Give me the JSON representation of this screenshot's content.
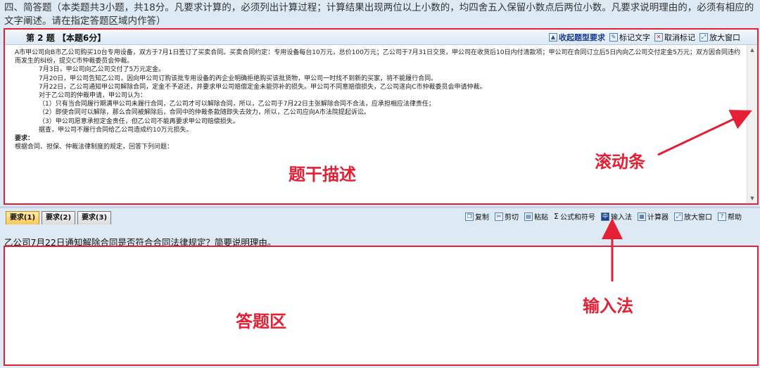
{
  "instructions": "四、简答题（本类题共3小题，共18分。凡要求计算的，必须列出计算过程；计算结果出现两位以上小数的，均四舍五入保留小数点后两位小数。凡要求说明理由的，必须有相应的文字阐述。请在指定答题区域内作答）",
  "question": {
    "title": "第 2 题  【本题6分】",
    "tools": [
      {
        "icon": "collapse-icon",
        "label": "收起题型要求"
      },
      {
        "icon": "mark-icon",
        "label": "标记文字"
      },
      {
        "icon": "unmark-icon",
        "label": "取消标记"
      },
      {
        "icon": "maximize-icon",
        "label": "放大窗口"
      }
    ],
    "paragraphs": [
      "A市甲公司向B市乙公司购买10台专用设备，双方于7月1日签订了买卖合同。买卖合同约定：专用设备每台10万元，总价100万元；乙公司于7月31日交货，甲公司在收货后10日内付清款项；甲公司在合同订立后5日内向乙公司交付定金5万元；双方因合同违约而发生的纠纷，提交C市仲裁委员会仲裁。",
      "7月3日，甲公司向乙公司交付了5万元定金。",
      "7月20日，甲公司告知乙公司，因向甲公司订购该批专用设备的丙企业明确拒绝购买该批货物，甲公司一时找不到新的买家，将不能履行合同。",
      "7月22日，乙公司通知甲公司解除合同，定金不予返还，并要求甲公司赔偿定金未能弥补的损失。甲公司不同意赔偿损失，乙公司遂向C市仲裁委员会申请仲裁。",
      "对于乙公司的仲裁申请，甲公司认为：",
      "（1）只有当合同履行期满甲公司未履行合同，乙公司才可以解除合同，所以，乙公司于7月22日主张解除合同不合法，应承担相应法律责任；",
      "（2）即使合同可以解除，那么合同被解除后，合同中的仲裁条款随即失去效力，所以，乙公司应向A市法院提起诉讼。",
      "（3）甲公司愿意承担定金责任，但乙公司不能再要求甲公司赔偿损失。",
      "据查，甲公司不履行合同给乙公司造成约10万元损失。",
      "要求：",
      "根据合同、担保、仲裁法律制度的规定，回答下列问题："
    ]
  },
  "annotations": {
    "stem": "题干描述",
    "scrollbar": "滚动条",
    "input_method": "输入法",
    "answer_area": "答题区"
  },
  "tabs": [
    "要求(1)",
    "要求(2)",
    "要求(3)"
  ],
  "edit_tools": [
    {
      "icon": "copy-icon",
      "label": "复制"
    },
    {
      "icon": "cut-icon",
      "label": "剪切"
    },
    {
      "icon": "paste-icon",
      "label": "粘贴"
    },
    {
      "icon": "formula-icon",
      "label": "公式和符号"
    },
    {
      "icon": "ime-icon",
      "label": "输入法"
    },
    {
      "icon": "calculator-icon",
      "label": "计算器"
    },
    {
      "icon": "maximize-icon",
      "label": "放大窗口"
    },
    {
      "icon": "help-icon",
      "label": "帮助"
    }
  ],
  "prompt": "乙公司7月22日通知解除合同是否符合合同法律规定？简要说明理由。",
  "colors": {
    "annotation": "#e32035",
    "background": "#ddeaf4"
  }
}
